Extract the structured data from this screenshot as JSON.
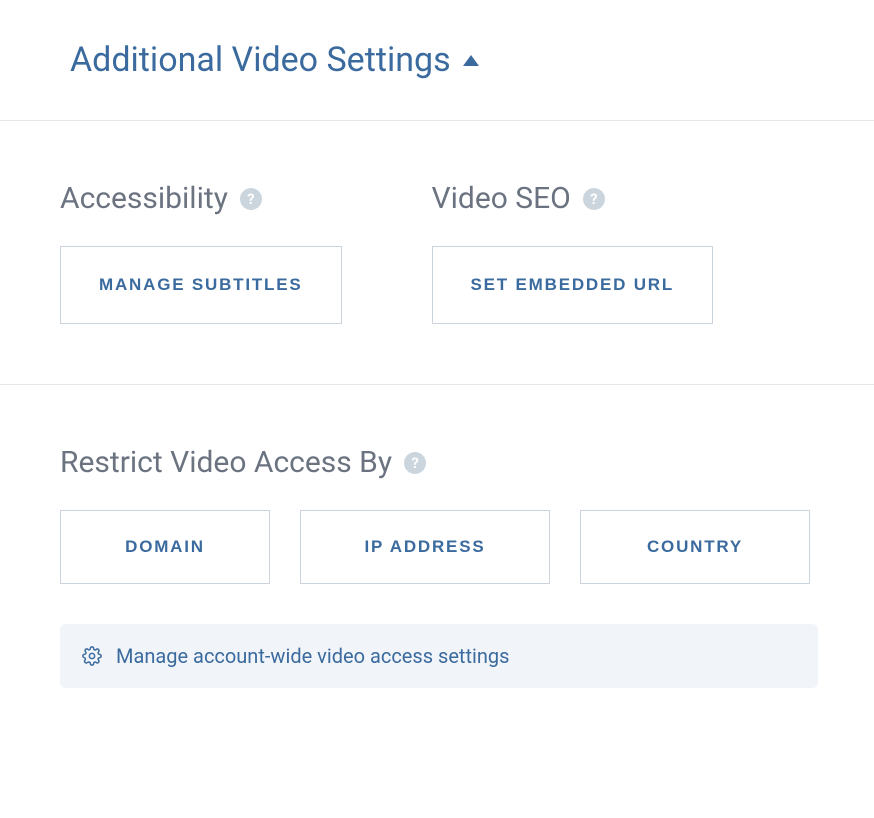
{
  "header": {
    "title": "Additional Video Settings"
  },
  "accessibility": {
    "heading": "Accessibility",
    "button": "MANAGE SUBTITLES"
  },
  "videoSeo": {
    "heading": "Video SEO",
    "button": "SET EMBEDDED URL"
  },
  "restrict": {
    "heading": "Restrict Video Access By",
    "buttons": {
      "domain": "DOMAIN",
      "ip": "IP ADDRESS",
      "country": "COUNTRY"
    },
    "banner": "Manage account-wide video access settings"
  }
}
